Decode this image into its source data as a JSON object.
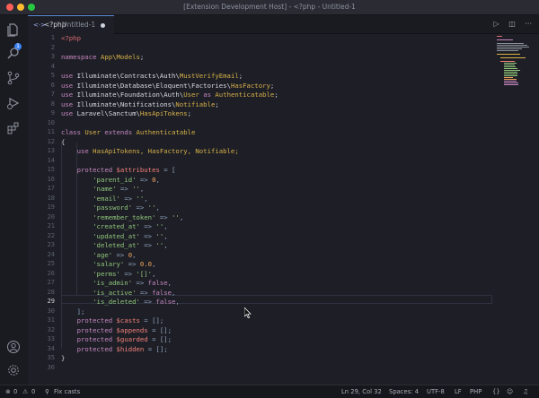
{
  "window": {
    "title": "[Extension Development Host] - <?php - Untitled-1"
  },
  "activity_bar": {
    "items": [
      "explorer-icon",
      "search-icon",
      "source-control-icon",
      "run-debug-icon",
      "extensions-icon"
    ],
    "badge_count": "1",
    "bottom_items": [
      "account-icon",
      "settings-gear-icon"
    ]
  },
  "tab": {
    "lang_marker": "<·>",
    "name": "<?php",
    "file": "Untitled-1"
  },
  "editor_actions": {
    "run": "▷",
    "split": "◫",
    "more": "···"
  },
  "line_numbers": [
    "1",
    "2",
    "3",
    "4",
    "5",
    "6",
    "7",
    "8",
    "9",
    "10",
    "11",
    "12",
    "13",
    "14",
    "15",
    "16",
    "17",
    "18",
    "19",
    "20",
    "21",
    "22",
    "23",
    "24",
    "25",
    "26",
    "27",
    "28",
    "29",
    "30",
    "31",
    "32",
    "33",
    "34",
    "35",
    "36"
  ],
  "active_line": "29",
  "code": {
    "l1_open": "<?php",
    "l3_kw": "namespace",
    "l3_ns": "App\\Models",
    "l3_end": ";",
    "use_kw": "use",
    "l5_ns": "Illuminate\\Contracts\\Auth\\",
    "l5_cls": "MustVerifyEmail",
    "l5_end": ";",
    "l6_ns": "Illuminate\\Database\\Eloquent\\Factories\\",
    "l6_cls": "HasFactory",
    "l6_end": ";",
    "l7_ns": "Illuminate\\Foundation\\Auth\\",
    "l7_cls": "User",
    "l7_as": "as",
    "l7_alias": "Authenticatable",
    "l7_end": ";",
    "l8_ns": "Illuminate\\Notifications\\",
    "l8_cls": "Notifiable",
    "l8_end": ";",
    "l9_ns": "Laravel\\Sanctum\\",
    "l9_cls": "HasApiTokens",
    "l9_end": ";",
    "l11_class": "class",
    "l11_name": "User",
    "l11_extends": "extends",
    "l11_parent": "Authenticatable",
    "l12": "{",
    "l13_use": "use",
    "l13_traits": "HasApiTokens, HasFactory, Notifiable;",
    "protected": "protected",
    "l15_var": "$attributes",
    "l15_op": " = [",
    "attrs": [
      {
        "key": "'parent_id'",
        "arrow": " => ",
        "val": "0",
        "type": "num"
      },
      {
        "key": "'name'",
        "arrow": " => ",
        "val": "''",
        "type": "str"
      },
      {
        "key": "'email'",
        "arrow": " => ",
        "val": "''",
        "type": "str"
      },
      {
        "key": "'password'",
        "arrow": " => ",
        "val": "''",
        "type": "str"
      },
      {
        "key": "'remember_token'",
        "arrow": " => ",
        "val": "''",
        "type": "str"
      },
      {
        "key": "'created_at'",
        "arrow": " => ",
        "val": "''",
        "type": "str"
      },
      {
        "key": "'updated_at'",
        "arrow": " => ",
        "val": "''",
        "type": "str"
      },
      {
        "key": "'deleted_at'",
        "arrow": " => ",
        "val": "''",
        "type": "str"
      },
      {
        "key": "'age'",
        "arrow": " => ",
        "val": "0",
        "type": "num"
      },
      {
        "key": "'salary'",
        "arrow": " => ",
        "val": "0.0",
        "type": "num"
      },
      {
        "key": "'perms'",
        "arrow": " => ",
        "val": "'[]'",
        "type": "str"
      },
      {
        "key": "'is_admin'",
        "arrow": " => ",
        "val": "false",
        "type": "kw"
      },
      {
        "key": "'is_active'",
        "arrow": " => ",
        "val": "false",
        "type": "kw"
      },
      {
        "key": "'is_deleted'",
        "arrow": " => ",
        "val": "false",
        "type": "kw"
      }
    ],
    "l30": "];",
    "l31_var": "$casts",
    "l32_var": "$appends",
    "l33_var": "$guarded",
    "l34_var": "$hidden",
    "empty_arr": " = [];",
    "l36": "}"
  },
  "status_bar": {
    "errors": "0",
    "warnings": "0",
    "fix": "Fix casts",
    "position": "Ln 29, Col 32",
    "spaces": "Spaces: 4",
    "encoding": "UTF-8",
    "eol": "LF",
    "language": "PHP"
  },
  "colors": {
    "accent": "#5a8bd6",
    "badge": "#3b82f6",
    "background": "#1e1f26"
  }
}
